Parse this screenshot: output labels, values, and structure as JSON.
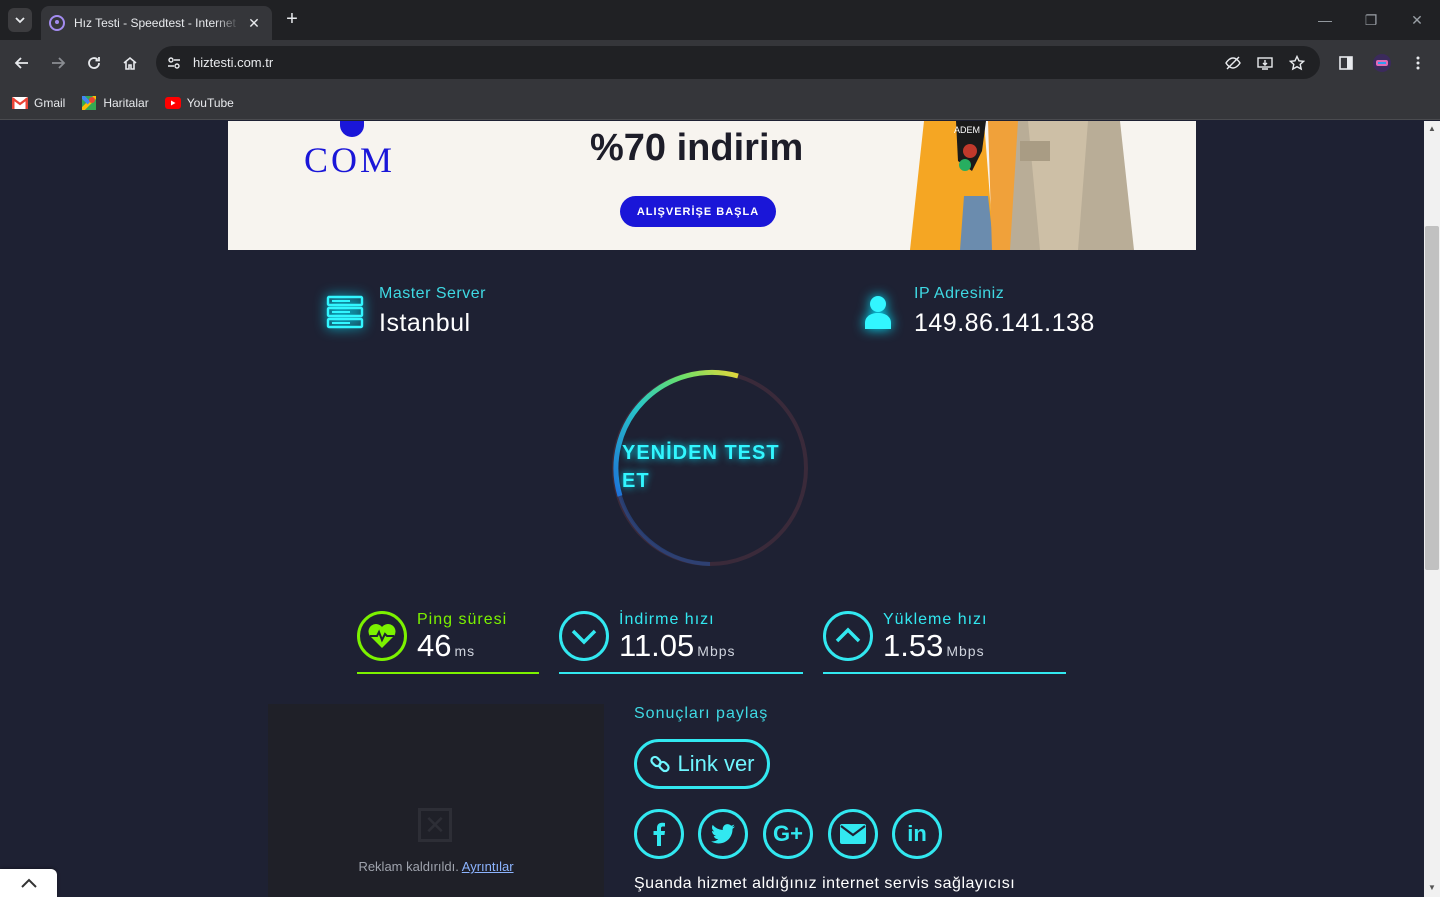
{
  "browser": {
    "tab_title": "Hız Testi - Speedtest - Internet Hız Testi",
    "url": "hiztesti.com.tr",
    "bookmarks": [
      {
        "label": "Gmail",
        "icon": "gmail-icon"
      },
      {
        "label": "Haritalar",
        "icon": "maps-icon"
      },
      {
        "label": "YouTube",
        "icon": "youtube-icon"
      }
    ]
  },
  "ad_banner": {
    "brand": "COM",
    "headline": "%70 indirim",
    "cta": "ALIŞVERİŞE BAŞLA"
  },
  "server": {
    "label": "Master Server",
    "value": "Istanbul",
    "icon": "server-icon"
  },
  "ip": {
    "label": "IP Adresiniz",
    "value": "149.86.141.138",
    "icon": "user-icon"
  },
  "gauge": {
    "button_label": "YENİDEN TEST ET"
  },
  "metrics": {
    "ping": {
      "label": "Ping süresi",
      "value": "46",
      "unit": "ms",
      "icon": "heartbeat-icon",
      "color": "#7cf200"
    },
    "download": {
      "label": "İndirme hızı",
      "value": "11.05",
      "unit": "Mbps",
      "icon": "chevron-down-icon",
      "color": "#32e8f0"
    },
    "upload": {
      "label": "Yükleme hızı",
      "value": "1.53",
      "unit": "Mbps",
      "icon": "chevron-up-icon",
      "color": "#32e8f0"
    }
  },
  "ad_removed": {
    "text": "Reklam kaldırıldı.",
    "link": "Ayrıntılar"
  },
  "share": {
    "title": "Sonuçları paylaş",
    "link_button": "Link ver",
    "socials": [
      "facebook-icon",
      "twitter-icon",
      "google-plus-icon",
      "email-icon",
      "linkedin-icon"
    ]
  },
  "isp_text": "Şuanda hizmet aldığınız internet servis sağlayıcısı",
  "colors": {
    "background": "#1e2133",
    "accent_cyan": "#32e8f0",
    "accent_green": "#7cf200"
  }
}
